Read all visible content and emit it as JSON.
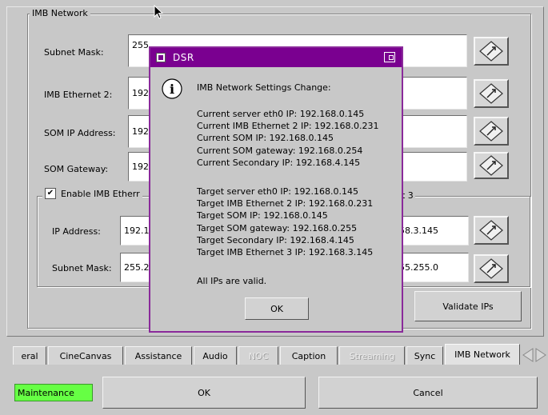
{
  "group_network": {
    "title": "IMB Network"
  },
  "fields": {
    "subnet_mask": {
      "label": "Subnet Mask:",
      "value": "255"
    },
    "imb_eth2": {
      "label": "IMB Ethernet 2:",
      "value": "192"
    },
    "som_ip": {
      "label": "SOM IP Address:",
      "value": "192"
    },
    "som_gateway": {
      "label": "SOM Gateway:",
      "value": "192"
    }
  },
  "group_eth3": {
    "checkbox_label": "Enable IMB Etherr",
    "checked_mark": "✔",
    "legend_right": "t 3",
    "ip_label": "IP Address:",
    "ip_value_left": "192.1",
    "ip_value_right": "58.3.145",
    "mask_label": "Subnet Mask:",
    "mask_value_left": "255.2",
    "mask_value_right": "55.255.0"
  },
  "validate_button": "Validate IPs",
  "tabs": [
    {
      "label": "eral",
      "state": "normal"
    },
    {
      "label": "CineCanvas",
      "state": "normal"
    },
    {
      "label": "Assistance",
      "state": "normal"
    },
    {
      "label": "Audio",
      "state": "normal"
    },
    {
      "label": "NOC",
      "state": "disabled"
    },
    {
      "label": "Caption",
      "state": "normal"
    },
    {
      "label": "Streaming",
      "state": "disabled"
    },
    {
      "label": "Sync",
      "state": "normal"
    },
    {
      "label": "IMB Network",
      "state": "active"
    }
  ],
  "footer": {
    "status": "Maintenance",
    "ok": "OK",
    "cancel": "Cancel",
    "status_color": "#66ff44"
  },
  "dialog": {
    "title": "DSR",
    "title_color": "#7a0090",
    "heading": "IMB Network Settings Change:",
    "current": [
      "Current server eth0 IP: 192.168.0.145",
      "Current IMB Ethernet 2 IP: 192.168.0.231",
      "Current SOM IP: 192.168.0.145",
      "Current SOM gateway: 192.168.0.254",
      "Current Secondary IP: 192.168.4.145"
    ],
    "target": [
      "Target server eth0 IP: 192.168.0.145",
      "Target IMB Ethernet 2 IP: 192.168.0.231",
      "Target SOM IP: 192.168.0.145",
      "Target SOM gateway: 192.168.0.255",
      "Target Secondary IP: 192.168.4.145",
      "Target IMB Ethernet 3 IP: 192.168.3.145"
    ],
    "valid_msg": "All IPs are valid.",
    "ok": "OK"
  }
}
